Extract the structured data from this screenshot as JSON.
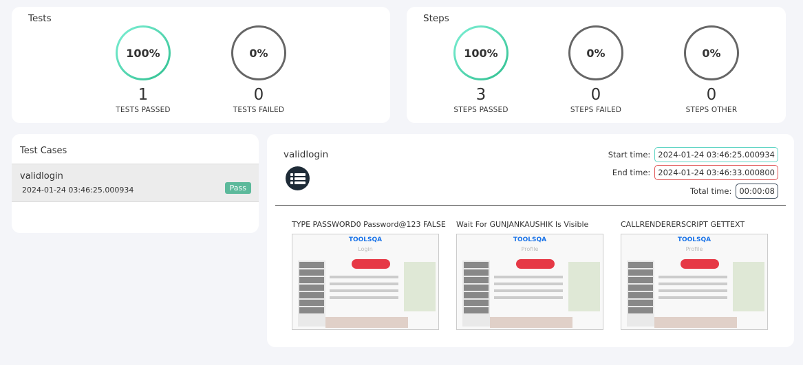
{
  "tests": {
    "title": "Tests",
    "stats": [
      {
        "percent": "100%",
        "count": "1",
        "label": "TESTS PASSED",
        "kind": "pass"
      },
      {
        "percent": "0%",
        "count": "0",
        "label": "TESTS FAILED",
        "kind": "grey"
      }
    ]
  },
  "steps": {
    "title": "Steps",
    "stats": [
      {
        "percent": "100%",
        "count": "3",
        "label": "STEPS PASSED",
        "kind": "pass"
      },
      {
        "percent": "0%",
        "count": "0",
        "label": "STEPS FAILED",
        "kind": "grey"
      },
      {
        "percent": "0%",
        "count": "0",
        "label": "STEPS OTHER",
        "kind": "grey"
      }
    ]
  },
  "test_cases": {
    "title": "Test Cases",
    "items": [
      {
        "name": "validlogin",
        "timestamp": "2024-01-24 03:46:25.000934",
        "status": "Pass"
      }
    ]
  },
  "detail": {
    "name": "validlogin",
    "start_label": "Start time:",
    "start_value": "2024-01-24 03:46:25.000934",
    "end_label": "End time:",
    "end_value": "2024-01-24 03:46:33.000800",
    "total_label": "Total time:",
    "total_value": "00:00:08",
    "colors": {
      "start": "#5fd4c4",
      "end": "#e05555",
      "total": "#3a4a5a"
    },
    "steps": [
      {
        "title": "TYPE PASSWORD0 Password@123 FALSE",
        "screen_logo": "TOOLSQA",
        "screen_heading": "Login"
      },
      {
        "title": "Wait For GUNJANKAUSHIK Is Visible",
        "screen_logo": "TOOLSQA",
        "screen_heading": "Profile"
      },
      {
        "title": "CALLRENDERERSCRIPT GETTEXT",
        "screen_logo": "TOOLSQA",
        "screen_heading": "Profile"
      }
    ]
  }
}
